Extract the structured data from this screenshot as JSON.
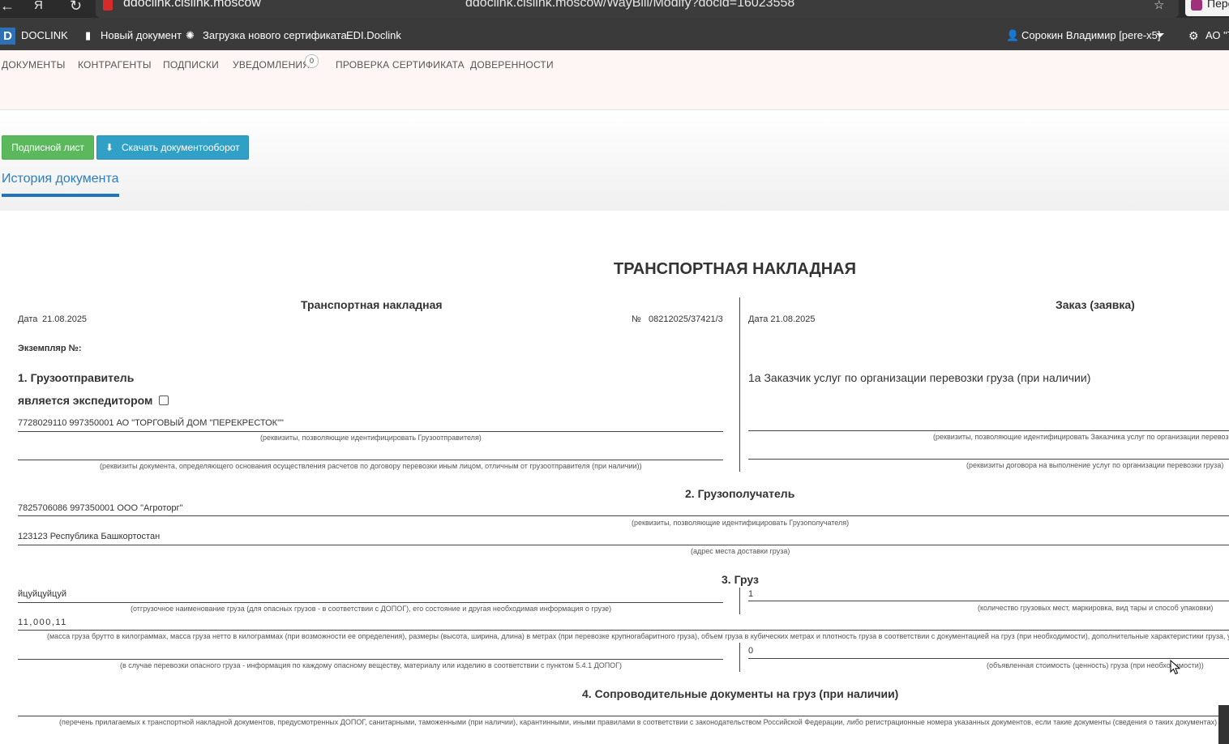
{
  "browser": {
    "host": "ddoclink.cislink.moscow",
    "url": "ddoclink.cislink.moscow/WayBill/Modify?docid=16023558",
    "ext_label": "Пере"
  },
  "navbar": {
    "brand": "DOCLINK",
    "new_document": "Новый документ",
    "upload_cert": "Загрузка нового сертификата",
    "edi": "EDI.Doclink",
    "user": "Сорокин Владимир [pere-x5]",
    "org": "АО \"Т"
  },
  "menu": {
    "items": [
      "ДОКУМЕНТЫ",
      "КОНТРАГЕНТЫ",
      "ПОДПИСКИ",
      "УВЕДОМЛЕНИЯ",
      "ПРОВЕРКА СЕРТИФИКАТА",
      "ДОВЕРЕННОСТИ"
    ],
    "notifications_count": "0"
  },
  "actions": {
    "sign_sheet": "Подписной лист",
    "download": "Скачать документооборот",
    "history_tab": "История документа"
  },
  "doc": {
    "title": "ТРАНСПОРТНАЯ НАКЛАДНАЯ",
    "left_header": "Транспортная накладная",
    "right_header": "Заказ (заявка)",
    "date_label": "Дата",
    "date_value": "21.08.2025",
    "number_label": "№",
    "number_value": "08212025/37421/3",
    "right_date": "Дата 21.08.2025",
    "copy_label": "Экземпляр №:",
    "s1_title": "1. Грузоотправитель",
    "s1_forwarder": "является экспедитором",
    "s1_value": "7728029110 997350001 АО \"ТОРГОВЫЙ ДОМ \"ПЕРЕКРЕСТОК\"\"",
    "s1_hint1": "(реквизиты, позволяющие идентифицировать Грузоотправителя)",
    "s1_hint2": "(реквизиты документа, определяющего основания осуществления расчетов по договору перевозки иным лицом, отличным от грузоотправителя (при наличии))",
    "s1a_title": "1а Заказчик услуг по организации перевозки груза (при наличии)",
    "s1a_hint1": "(реквизиты, позволяющие идентифицировать Заказчика услуг по организации перевоз",
    "s1a_hint2": "(реквизиты договора на выполнение услуг по организации перевозки груза)",
    "s2_title": "2. Грузополучатель",
    "s2_value": "7825706086 997350001 ООО \"Агроторг\"",
    "s2_hint1": "(реквизиты, позволяющие идентифицировать Грузополучателя)",
    "s2_address": "123123 Республика Башкортостан",
    "s2_hint2": "(адрес места доставки груза)",
    "s3_title": "3. Груз",
    "s3_name": "йцуйцуйцуй",
    "s3_hint_name": "(отгрузочное наименование груза (для опасных грузов - в соответствии с ДОПОГ), его состояние и другая необходимая информация о грузе)",
    "s3_places": "1",
    "s3_hint_places": "(количество грузовых мест, маркировка, вид тары и способ упаковки)",
    "s3_mass": "11,000,11",
    "s3_hint_mass": "(масса груза брутто в килограммах, масса груза нетто в килограммах (при возможности ее определения), размеры (высота, ширина, длина) в метрах (при перевозке крупногабаритного груза), объем груза в кубических метрах и плотность груза в соответствии с документацией на груз (при необходимости), дополнительные характеристики груза, у",
    "s3_hint_danger": "(в случае перевозки опасного груза - информация по каждому опасному веществу, материалу или изделию в соответствии с пунктом 5.4.1 ДОПОГ)",
    "s3_value": "0",
    "s3_hint_value": "(объявленная стоимость (ценность) груза (при необходимости))",
    "s4_title": "4. Сопроводительные документы на груз (при наличии)",
    "s4_hint": "(перечень прилагаемых к транспортной накладной документов, предусмотренных ДОПОГ, санитарными, таможенными (при наличии), карантинными, иными правилами в соответствии с законодательством Российской Федерации, либо регистрационные номера указанных документов, если такие документы (сведения о таких документах) с"
  }
}
